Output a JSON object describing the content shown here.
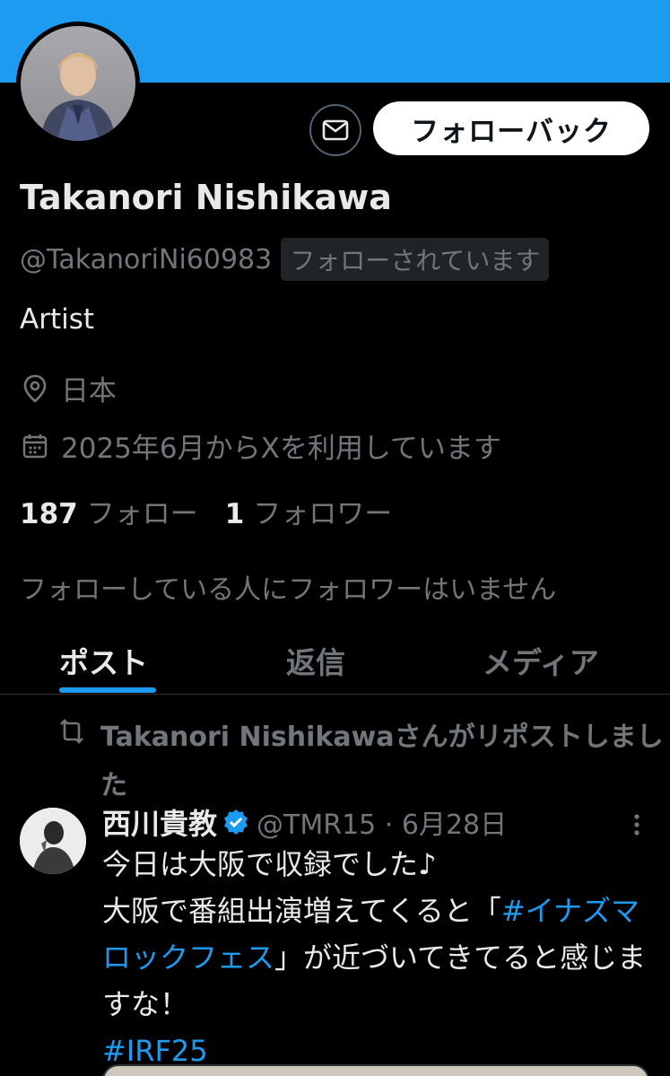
{
  "profile": {
    "followback_label": "フォローバック",
    "name": "Takanori Nishikawa",
    "handle": "@TakanoriNi60983",
    "follows_you": "フォローされています",
    "bio": "Artist",
    "location": "日本",
    "joined": "2025年6月からXを利用しています",
    "following_count": "187",
    "following_label": "フォロー",
    "followers_count": "1",
    "followers_label": "フォロワー",
    "no_followers_note": "フォローしている人にフォロワーはいません"
  },
  "tabs": [
    {
      "label": "ポスト",
      "active": true
    },
    {
      "label": "返信",
      "active": false
    },
    {
      "label": "メディア",
      "active": false
    }
  ],
  "post": {
    "repost_text": "Takanori Nishikawaさんがリポストしました",
    "author_name": "西川貴教",
    "author_handle": "@TMR15 · 6月28日",
    "line1": "今日は大阪で収録でした♪",
    "line2_pre": "大阪で番組出演増えてくると「",
    "hashtag1": "#イナズマロックフェス",
    "line2_post": "」が近づいてきてると感じますな！",
    "hashtag2": "#IRF25"
  },
  "colors": {
    "accent": "#1d9bf0",
    "background": "#000000",
    "secondary_text": "#71767b"
  }
}
